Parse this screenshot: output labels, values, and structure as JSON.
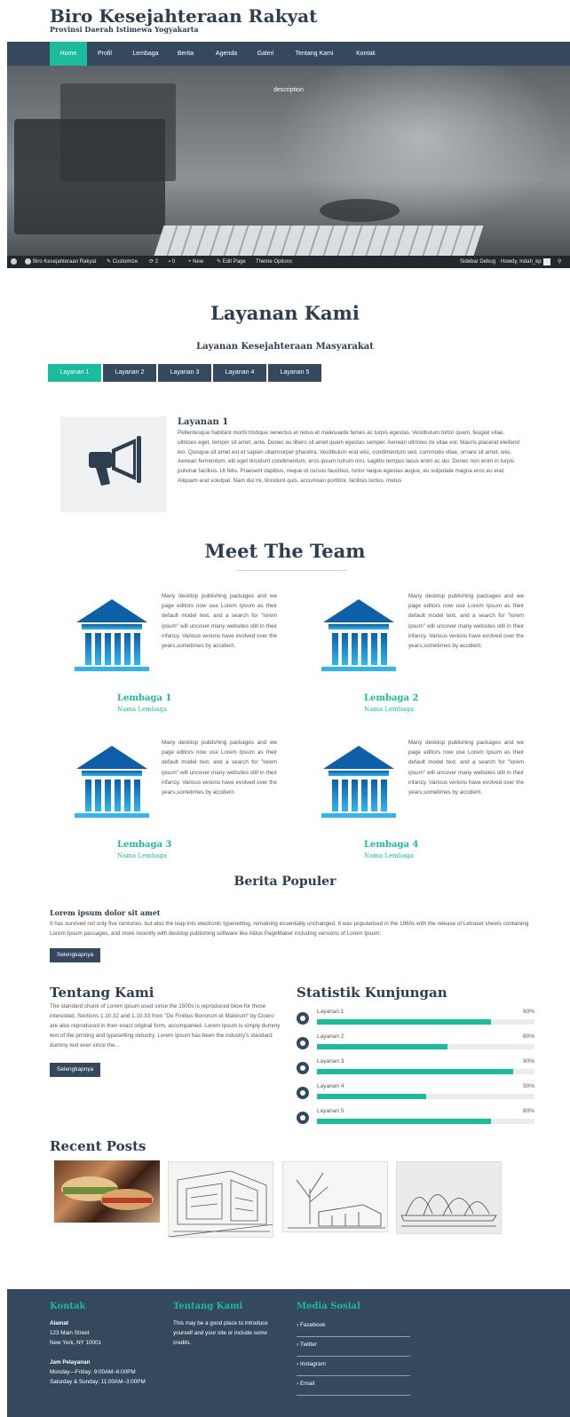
{
  "site": {
    "title": "Biro Kesejahteraan Rakyat",
    "subtitle": "Provinsi Daerah Istimewa Yogyakarta"
  },
  "nav": {
    "items": [
      "Home",
      "Profil",
      "Lembaga",
      "Berita",
      "Agenda",
      "Galeri",
      "Tentang Kami",
      "Kontak"
    ]
  },
  "hero": {
    "description": "description"
  },
  "adminbar": {
    "site": "Biro Kesejahteraan Rakyat",
    "customize": "Customize",
    "updates": "2",
    "comments": "0",
    "new": "New",
    "edit": "Edit Page",
    "theme": "Theme Options",
    "sidebar_debug": "Sidebar Debug",
    "howdy": "Howdy, indah_kp"
  },
  "layanan": {
    "heading": "Layanan Kami",
    "subheading": "Layanan Kesejahteraan Masyarakat",
    "tabs": [
      "Layanan 1",
      "Layanan 2",
      "Layanan 3",
      "Layanan 4",
      "Layanan 5"
    ],
    "active_title": "Layanan 1",
    "active_text": "Pellentesque habitant morbi tristique senectus et netus et malesuada fames ac turpis egestas. Vestibulum tortor quam, feugiat vitae, ultricies eget, tempor sit amet, ante. Donec eu libero sit amet quam egestas semper. Aenean ultricies mi vitae est. Mauris placerat eleifend leo. Quisque sit amet est et sapien ullamcorper pharetra. Vestibulum erat wisi, condimentum sed, commodo vitae, ornare sit amet, wisi. Aenean fermentum, elit eget tincidunt condimentum, eros ipsum rutrum orci, sagittis tempus lacus enim ac dui. Donec non enim in turpis pulvinar facilisis. Ut felis. Praesent dapibus, neque id cursus faucibus, tortor neque egestas augue, eu vulputate magna eros eu erat. Aliquam erat volutpat. Nam dui mi, tincidunt quis, accumsan porttitor, facilisis luctus, metus"
  },
  "team": {
    "heading": "Meet The Team",
    "members": [
      {
        "name": "Lembaga 1",
        "sub": "Nama Lembaga",
        "desc": "Many desktop publishing packages and we page editors now use Lorem Ipsum as their default model text, and a search for \"lorem ipsum\" will uncover many websites still in their infancy. Various verions have evolved over the years,sometimes by accident."
      },
      {
        "name": "Lembaga 2",
        "sub": "Nama Lembaga",
        "desc": "Many desktop publishing packages and we page editors now use Lorem Ipsum as their default model text, and a search for \"lorem ipsum\" will uncover many websites still in their infancy. Various verions have evolved over the years,sometimes by accident."
      },
      {
        "name": "Lembaga 3",
        "sub": "Nama Lembaga",
        "desc": "Many desktop publishing packages and we page editors now use Lorem Ipsum as their default model text, and a search for \"lorem ipsum\" will uncover many websites still in their infancy. Various verions have evolved over the years,sometimes by accident."
      },
      {
        "name": "Lembaga 4",
        "sub": "Nama Lembaga",
        "desc": "Many desktop publishing packages and we page editors now use Lorem Ipsum as their default model text, and a search for \"lorem ipsum\" will uncover many websites still in their infancy. Various verions have evolved over the years,sometimes by accident."
      }
    ]
  },
  "berita": {
    "heading": "Berita Populer",
    "title": "Lorem ipsum dolor sit amet",
    "text": "It has survived not only five centuries, but also the leap into electronic typesetting, remaining essentially unchanged. It was popularised in the 1960s with the release of Letraset sheets containing Lorem Ipsum passages, and more recently with desktop publishing software like Aldus PageMaker including versions of Lorem Ipsum.",
    "button": "Selengkapnya"
  },
  "tentang": {
    "heading": "Tentang Kami",
    "text": "The standard chunk of Lorem Ipsum used since the 1500s is reproduced blow for those interested. Sections 1.10.32 and 1.10.33 from \"De Finibus Bonorum et Malorum\" by Cicero are also reproduced in their exact original form, accompanied. Lorem Ipsum is simply dummy text of the printing and typesetting industry. Lorem Ipsum has been the industry's standard dummy text ever since the...",
    "button": "Selengkapnya"
  },
  "statistik": {
    "heading": "Statistik Kunjungan",
    "items": [
      {
        "label": "Layanan 1",
        "pct": "80%",
        "value": 0.8
      },
      {
        "label": "Layanan 2",
        "pct": "60%",
        "value": 0.6
      },
      {
        "label": "Layanan 3",
        "pct": "90%",
        "value": 0.9
      },
      {
        "label": "Layanan 4",
        "pct": "50%",
        "value": 0.5
      },
      {
        "label": "Layanan 5",
        "pct": "80%",
        "value": 0.8
      }
    ]
  },
  "recent": {
    "heading": "Recent Posts"
  },
  "footer": {
    "kontak_heading": "Kontak",
    "alamat_label": "Alamat",
    "alamat_line1": "123 Main Street",
    "alamat_line2": "New York, NY 10001",
    "jam_label": "Jam Pelayanan",
    "jam_line1": "Monday—Friday: 9:00AM–6:00PM",
    "jam_line2": "Saturday & Sunday: 11:00AM–3:00PM",
    "tentang_heading": "Tentang Kami",
    "tentang_text": "This may be a good place to introduce yourself and your site or include some credits.",
    "sosial_heading": "Media Sosial",
    "links": [
      "Facebook",
      "Twitter",
      "Instagram",
      "Email"
    ]
  }
}
